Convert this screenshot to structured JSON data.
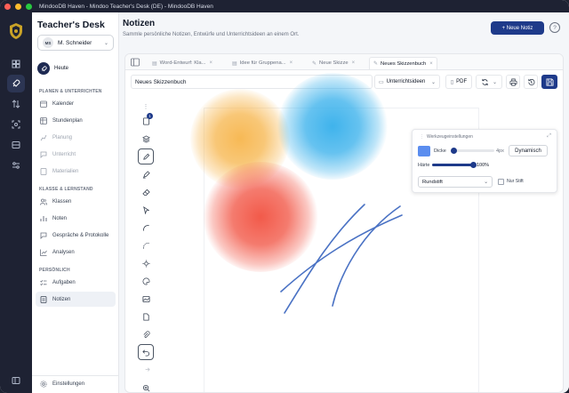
{
  "window": {
    "title": "MindooDB Haven - Mindoo Teacher's Desk (DE) - MindooDB Haven"
  },
  "sidebar": {
    "brand": "Teacher's Desk",
    "user": {
      "initials": "MS",
      "name": "M. Schneider"
    },
    "today": "Heute",
    "sections": [
      {
        "label": "PLANEN & UNTERRICHTEN"
      },
      {
        "label": "KLASSE & LERNSTAND"
      },
      {
        "label": "PERSÖNLICH"
      }
    ],
    "items": [
      {
        "label": "Kalender",
        "icon": "calendar-icon"
      },
      {
        "label": "Stundenplan",
        "icon": "timetable-icon"
      },
      {
        "label": "Planung",
        "icon": "planning-icon"
      },
      {
        "label": "Unterricht",
        "icon": "lesson-icon"
      },
      {
        "label": "Materialien",
        "icon": "materials-icon"
      },
      {
        "label": "Klassen",
        "icon": "classes-icon"
      },
      {
        "label": "Noten",
        "icon": "grades-icon"
      },
      {
        "label": "Gespräche & Protokolle",
        "icon": "conversations-icon"
      },
      {
        "label": "Analysen",
        "icon": "analytics-icon"
      },
      {
        "label": "Aufgaben",
        "icon": "tasks-icon"
      },
      {
        "label": "Notizen",
        "icon": "notes-icon"
      }
    ],
    "settings": "Einstellungen"
  },
  "header": {
    "title": "Notizen",
    "subtitle": "Sammle persönliche Notizen, Entwürfe und Unterrichtsideen an einem Ort.",
    "new_button": "+ Neue Notiz",
    "help": "?"
  },
  "tabs": [
    {
      "label": "Word-Entwurf: Kla...",
      "active": false
    },
    {
      "label": "Idee für Gruppena...",
      "active": false
    },
    {
      "label": "Neue Skizze",
      "active": false
    },
    {
      "label": "Neues Skizzenbuch",
      "active": true
    }
  ],
  "editor": {
    "name_value": "Neues Skizzenbuch",
    "category": "Unterrichtsideen",
    "pdf_label": "PDF",
    "layer_badge": "1"
  },
  "tool_panel": {
    "title": "Werkzeugeinstellungen",
    "color": "#5b8def",
    "thickness_label": "Dicke",
    "thickness_value": "4px",
    "thickness_level": 0.05,
    "dynamic_button": "Dynamisch",
    "hardness_label": "Härte",
    "hardness_value": "100%",
    "hardness_level": 1.0,
    "pen_type": "Rundstift",
    "pen_only_label": "Nur Stift",
    "pen_only_checked": false
  },
  "canvas": {
    "blob_colors": [
      "#f7b955",
      "#3fb3ec",
      "#f25a4a"
    ],
    "stroke_color": "#4a72c4"
  }
}
